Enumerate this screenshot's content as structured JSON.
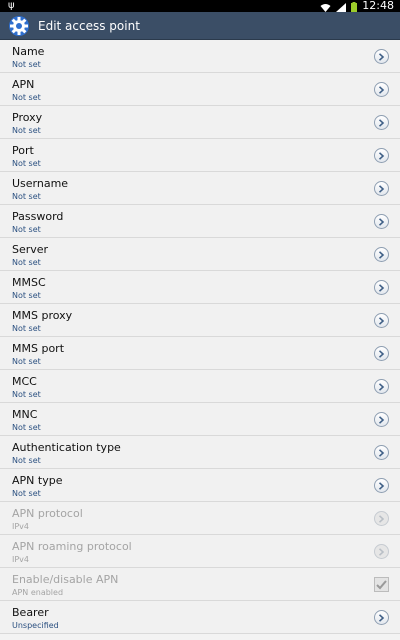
{
  "status_bar": {
    "time": "12:48",
    "icons": [
      "usb-icon",
      "wifi-icon",
      "signal-icon",
      "battery-icon"
    ]
  },
  "action_bar": {
    "title": "Edit access point",
    "icon": "settings-gear-icon"
  },
  "settings": [
    {
      "label": "Name",
      "value": "Not set",
      "enabled": true,
      "control": "chevron"
    },
    {
      "label": "APN",
      "value": "Not set",
      "enabled": true,
      "control": "chevron"
    },
    {
      "label": "Proxy",
      "value": "Not set",
      "enabled": true,
      "control": "chevron"
    },
    {
      "label": "Port",
      "value": "Not set",
      "enabled": true,
      "control": "chevron"
    },
    {
      "label": "Username",
      "value": "Not set",
      "enabled": true,
      "control": "chevron"
    },
    {
      "label": "Password",
      "value": "Not set",
      "enabled": true,
      "control": "chevron"
    },
    {
      "label": "Server",
      "value": "Not set",
      "enabled": true,
      "control": "chevron"
    },
    {
      "label": "MMSC",
      "value": "Not set",
      "enabled": true,
      "control": "chevron"
    },
    {
      "label": "MMS proxy",
      "value": "Not set",
      "enabled": true,
      "control": "chevron"
    },
    {
      "label": "MMS port",
      "value": "Not set",
      "enabled": true,
      "control": "chevron"
    },
    {
      "label": "MCC",
      "value": "Not set",
      "enabled": true,
      "control": "chevron"
    },
    {
      "label": "MNC",
      "value": "Not set",
      "enabled": true,
      "control": "chevron"
    },
    {
      "label": "Authentication type",
      "value": "Not set",
      "enabled": true,
      "control": "chevron"
    },
    {
      "label": "APN type",
      "value": "Not set",
      "enabled": true,
      "control": "chevron"
    },
    {
      "label": "APN protocol",
      "value": "IPv4",
      "enabled": false,
      "control": "chevron"
    },
    {
      "label": "APN roaming protocol",
      "value": "IPv4",
      "enabled": false,
      "control": "chevron"
    },
    {
      "label": "Enable/disable APN",
      "value": "APN enabled",
      "enabled": false,
      "control": "checkbox",
      "checked": true
    },
    {
      "label": "Bearer",
      "value": "Unspecified",
      "enabled": true,
      "control": "chevron"
    }
  ]
}
